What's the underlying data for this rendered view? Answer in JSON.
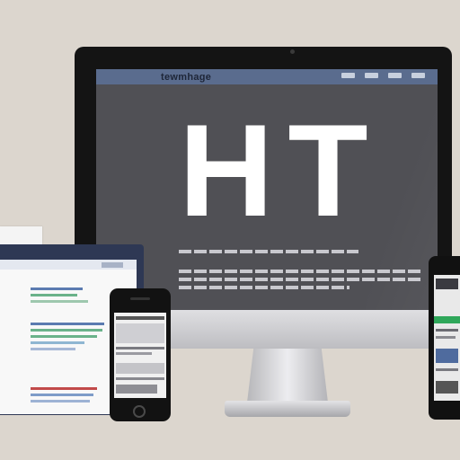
{
  "desktop": {
    "brand": "tewmhage",
    "nav_links": [
      "link-1",
      "link-2",
      "link-3",
      "link-4"
    ],
    "hero_text": "HT"
  },
  "colors": {
    "background": "#dcd6ce",
    "screen_bg": "#505055",
    "navbar": "#5a6c8e",
    "laptop_frame": "#2e3854",
    "doc_blue": "#5b7bb0",
    "doc_green": "#6ab28a",
    "doc_red": "#c24a4a",
    "phone_green": "#2fa75a"
  },
  "icons": [
    "camera-icon",
    "home-button-icon",
    "speaker-icon"
  ]
}
